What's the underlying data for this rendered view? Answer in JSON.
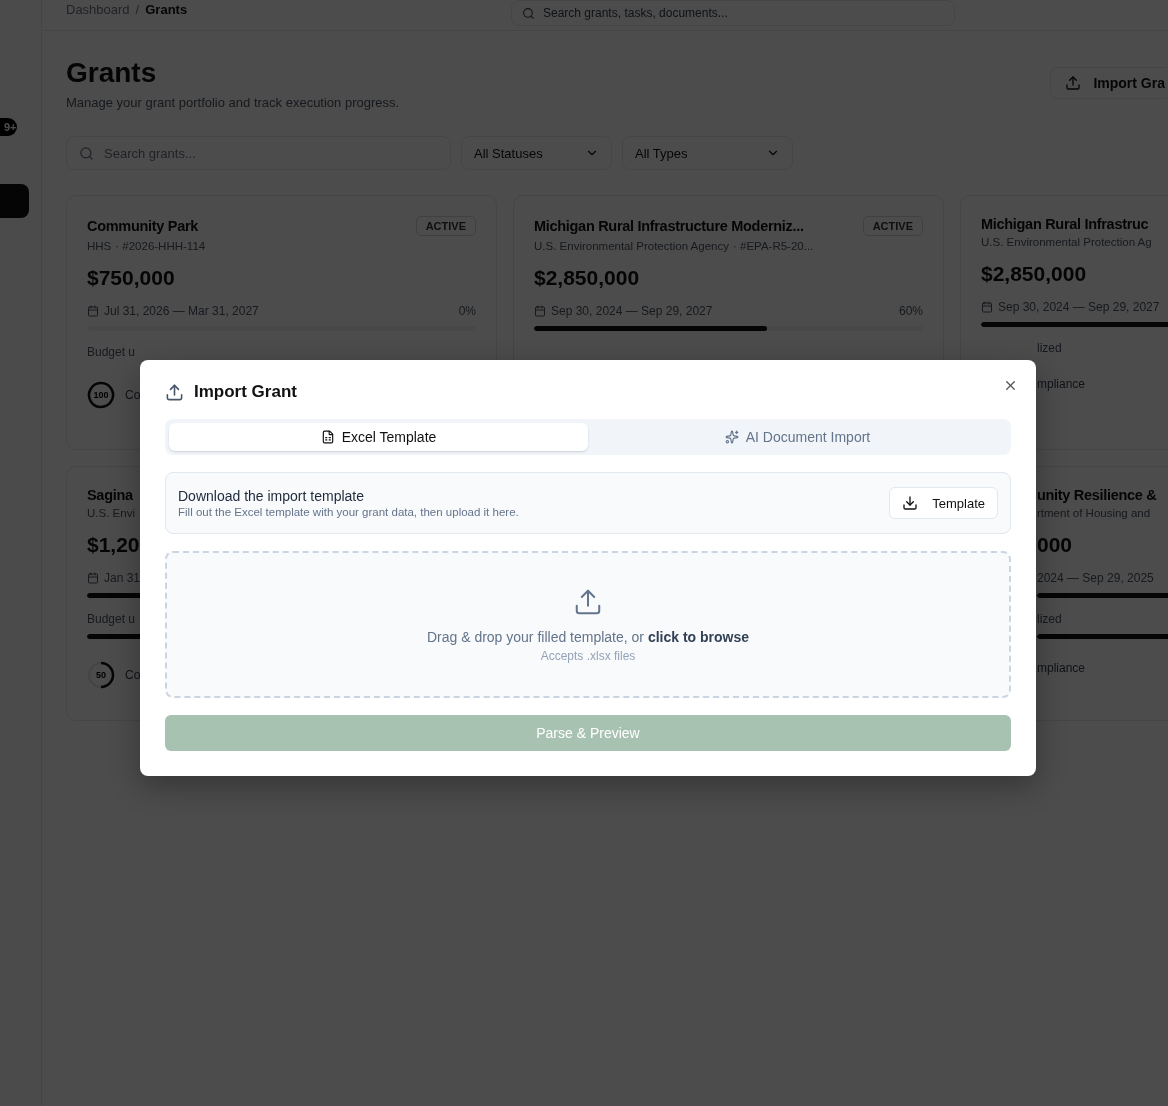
{
  "sidebar": {
    "badge": "9+",
    "items": [
      {
        "selected": true
      }
    ]
  },
  "topbar": {
    "breadcrumb": [
      "Dashboard",
      "Grants"
    ],
    "separator": "/",
    "search": {
      "placeholder": "Search grants, tasks, documents..."
    }
  },
  "page": {
    "title": "Grants",
    "subtitle": "Manage your grant portfolio and track execution progress.",
    "import_button": "Import Gra"
  },
  "filters": {
    "search": {
      "placeholder": "Search grants..."
    },
    "selects": [
      "All Statuses",
      "All Types"
    ]
  },
  "cards": [
    {
      "title": "Community Park",
      "status": "ACTIVE",
      "agency": "HHS",
      "code": "· #2026-HHH-114",
      "amount": "$750,000",
      "dates": "Jul 31, 2026 — Mar 31, 2027",
      "percent": "0%",
      "budget_label": "Budget u",
      "score": {
        "value": "100",
        "level": 1
      },
      "compliance": "Co"
    },
    {
      "title": "Michigan Rural Infrastructure Moderniz...",
      "status": "ACTIVE",
      "agency": "U.S. Environmental Protection Agency",
      "code": "· #EPA-R5-20...",
      "amount": "$2,850,000",
      "dates": "Sep 30, 2024 — Sep 29, 2027",
      "percent": "60%",
      "progress": {
        "level": 0.6
      }
    },
    {
      "title": "Michigan Rural Infrastruc",
      "agency": "U.S. Environmental Protection Ag",
      "amount": "$2,850,000",
      "dates": "Sep 30, 2024 — Sep 29, 2027",
      "progress": {
        "level": 0.6
      },
      "budget_label": "lized",
      "compliance": "mpliance"
    },
    {
      "title": "Sagina",
      "agency": "U.S. Envi",
      "amount": "$1,20",
      "dates": "Jan 31",
      "progress": {
        "level": 0.9
      },
      "budget_label": "Budget u",
      "budget": {
        "level": 0.5
      },
      "score": {
        "value": "50",
        "level": 0.5
      },
      "compliance": "Co"
    },
    {
      "title": "unity Resilience &",
      "agency": "rtment of Housing and",
      "amount": "000",
      "dates": "2024 — Sep 29, 2025",
      "progress": {
        "level": 0.9
      },
      "budget_label": "lized",
      "budget": {
        "level": 0.9
      },
      "compliance": "mpliance"
    }
  ],
  "modal": {
    "title": "Import Grant",
    "tabs": [
      {
        "label": "Excel Template",
        "selected": true
      },
      {
        "label": "AI Document Import",
        "selected": false
      }
    ],
    "template": {
      "title": "Download the import template",
      "description": "Fill out the Excel template with your grant data, then upload it here.",
      "button": "Template"
    },
    "dropzone": {
      "text": "Drag & drop your filled template, or **click to browse**",
      "hint": "Accepts .xlsx files"
    },
    "submit": {
      "label": "Parse & Preview",
      "disabled": true
    }
  }
}
